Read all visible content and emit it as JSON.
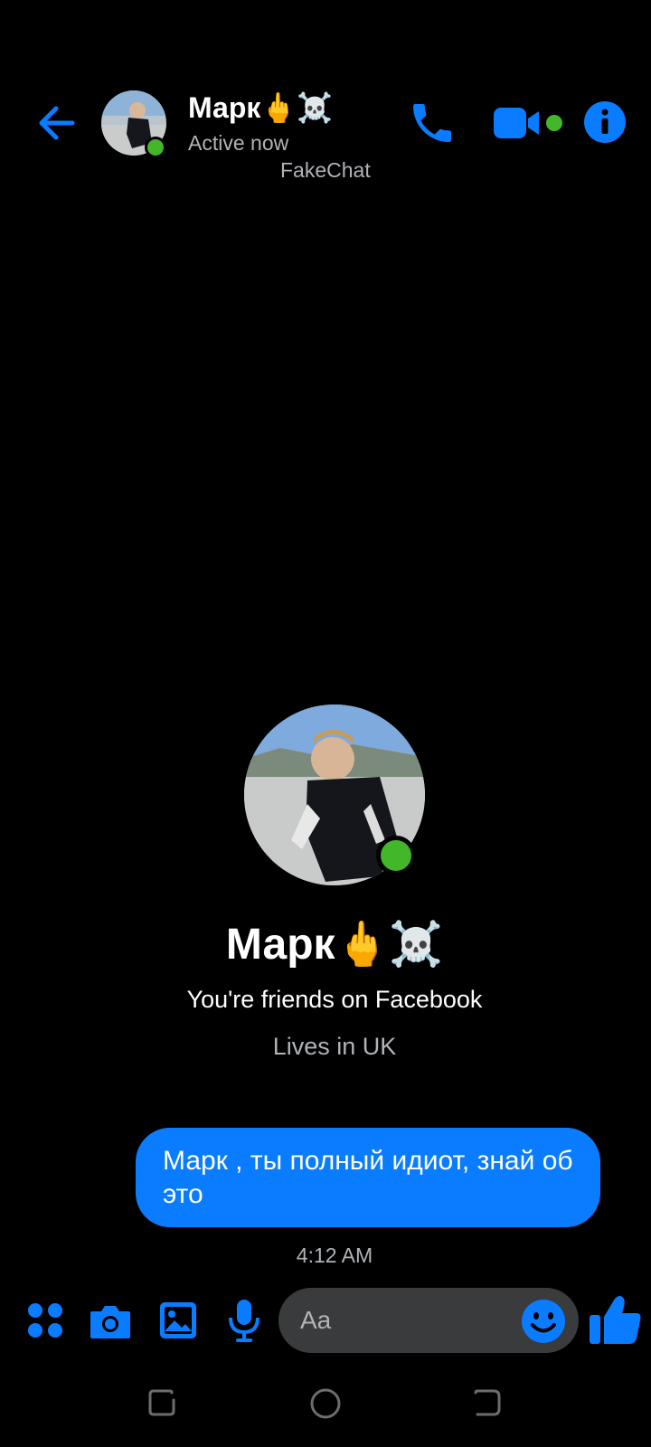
{
  "header": {
    "contact_name": "Марк🖕☠️",
    "status": "Active now",
    "watermark": "FakeChat"
  },
  "profile": {
    "name": "Марк🖕☠️",
    "friends_text": "You're friends on Facebook",
    "location": "Lives in UK"
  },
  "messages": [
    {
      "text": "Марк , ты полный идиот, знай об это",
      "sender": "me"
    }
  ],
  "timestamp": "4:12 AM",
  "composer": {
    "placeholder": "Aa"
  },
  "icons": {
    "back": "back-arrow-icon",
    "call": "phone-icon",
    "video": "video-camera-icon",
    "info": "info-icon",
    "apps": "apps-grid-icon",
    "camera": "camera-icon",
    "gallery": "image-icon",
    "mic": "microphone-icon",
    "emoji": "emoji-icon",
    "like": "thumbs-up-icon"
  },
  "colors": {
    "accent": "#0a7cff",
    "online": "#42b72a",
    "background": "#000000",
    "secondary_text": "#b0b3b8",
    "input_bg": "#3a3b3c"
  }
}
